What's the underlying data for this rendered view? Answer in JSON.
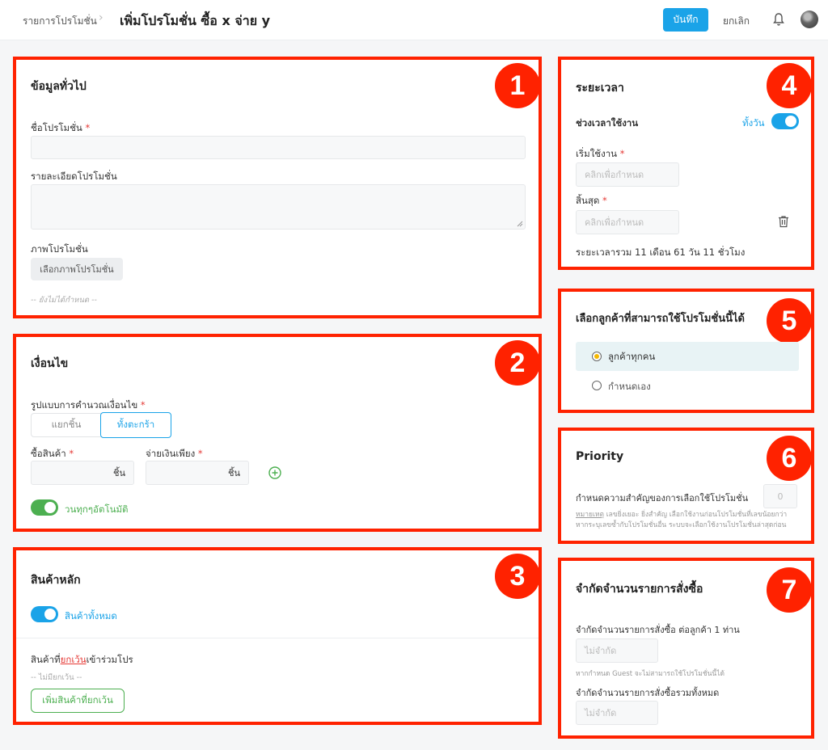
{
  "header": {
    "breadcrumb": "รายการโปรโมชั่น",
    "separator": "›",
    "title": "เพิ่มโปรโมชั่น ซื้อ x จ่าย y",
    "save_label": "บันทึก",
    "cancel_label": "ยกเลิก"
  },
  "badges": [
    "1",
    "2",
    "3",
    "4",
    "5",
    "6",
    "7"
  ],
  "general": {
    "heading": "ข้อมูลทั่วไป",
    "name_label": "ชื่อโปรโมชั่น",
    "desc_label": "รายละเอียดโปรโมชั่น",
    "image_label": "ภาพโปรโมชั่น",
    "image_button": "เลือกภาพโปรโมชั่น",
    "image_hint": "-- ยังไม่ได้กำหนด --"
  },
  "condition": {
    "heading": "เงื่อนไข",
    "calc_label": "รูปแบบการคำนวณเงื่อนไข",
    "calc_options": [
      "แยกชิ้น",
      "ทั้งตะกร้า"
    ],
    "buy_label": "ซื้อสินค้า",
    "pay_label": "จ่ายเงินเพียง",
    "unit": "ชิ้น",
    "auto_loop_label": "วนทุกๆอัตโนมัติ"
  },
  "products": {
    "heading": "สินค้าหลัก",
    "all_products_label": "สินค้าทั้งหมด",
    "excluded_prefix": "สินค้าที่",
    "excluded_highlight": "ยกเว้น",
    "excluded_suffix": "เข้าร่วมโปร",
    "none_excluded": "-- ไม่มียกเว้น --",
    "add_excluded_button": "เพิ่มสินค้าที่ยกเว้น"
  },
  "period": {
    "heading": "ระยะเวลา",
    "usage_label": "ช่วงเวลาใช้งาน",
    "allday_label": "ทั้งวัน",
    "start_label": "เริ่มใช้งาน",
    "start_placeholder": "คลิกเพื่อกำหนด",
    "end_label": "สิ้นสุด",
    "end_placeholder": "คลิกเพื่อกำหนด",
    "total": "ระยะเวลารวม 11 เดือน 61 วัน 11 ชั่วโมง"
  },
  "customers": {
    "heading": "เลือกลูกค้าที่สามารถใช้โปรโมชั่นนี้ได้",
    "options": [
      "ลูกค้าทุกคน",
      "กำหนดเอง"
    ]
  },
  "priority": {
    "heading": "Priority",
    "label": "กำหนดความสำคัญของการเลือกใช้โปรโมชั่น",
    "value": "0",
    "note_prefix": "หมายเหตุ",
    "note_line1": " เลขยิ่งเยอะ ยิ่งสำคัญ เลือกใช้งานก่อนโปรโมชั่นที่เลขน้อยกว่า",
    "note_line2": "หากระบุเลขซ้ำกับโปรโมชั่นอื่น ระบบจะเลือกใช้งานโปรโมชั่นล่าสุดก่อน"
  },
  "limit": {
    "heading": "จำกัดจำนวนรายการสั่งซื้อ",
    "per_customer_label": "จำกัดจำนวนรายการสั่งซื้อ ต่อลูกค้า 1 ท่าน",
    "per_customer_placeholder": "ไม่จำกัด",
    "guest_note": "หากกำหนด Guest จะไม่สามารถใช้โปรโมชั่นนี้ได้",
    "total_label": "จำกัดจำนวนรายการสั่งซื้อรวมทั้งหมด",
    "total_placeholder": "ไม่จำกัด"
  },
  "colors": {
    "accent": "#1aa3e8",
    "green": "#4caf50",
    "highlight": "#ff2200"
  }
}
